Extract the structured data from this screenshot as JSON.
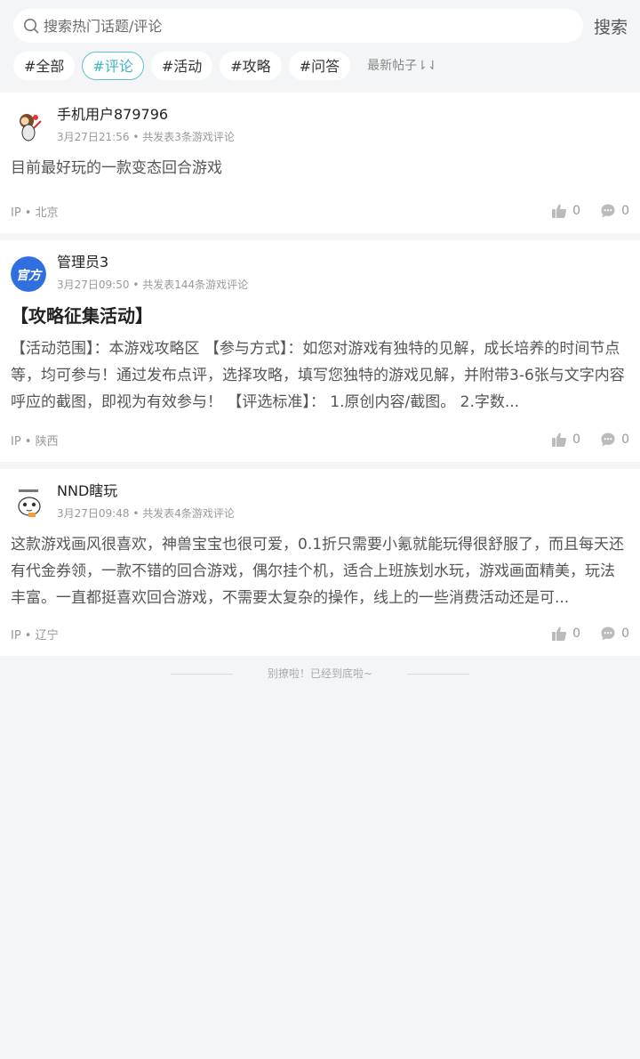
{
  "search": {
    "placeholder": "搜索热门话题/评论",
    "button_label": "搜索"
  },
  "tags": [
    {
      "label": "#全部",
      "active": false
    },
    {
      "label": "#评论",
      "active": true
    },
    {
      "label": "#活动",
      "active": false
    },
    {
      "label": "#攻略",
      "active": false
    },
    {
      "label": "#问答",
      "active": false
    }
  ],
  "sort": {
    "label": "最新帖子⇂⇃"
  },
  "posts": [
    {
      "user": "手机用户879796",
      "time": "3月27日21:56",
      "count": "共发表3条游戏评论",
      "title": "",
      "text": "目前最好玩的一款变态回合游戏",
      "ip": "IP • 北京",
      "likes": "0",
      "comments": "0"
    },
    {
      "user": "管理员3",
      "avatar_label": "官方",
      "time": "3月27日09:50",
      "count": "共发表144条游戏评论",
      "title": "【攻略征集活动】",
      "text": "【活动范围】：本游戏攻略区 【参与方式】：如您对游戏有独特的见解，成长培养的时间节点等，均可参与！通过发布点评，选择攻略，填写您独特的游戏见解，并附带3-6张与文字内容呼应的截图，即视为有效参与！ 【评选标准】： 1.原创内容/截图。 2.字数...",
      "ip": "IP • 陕西",
      "likes": "0",
      "comments": "0"
    },
    {
      "user": "NND瞎玩",
      "time": "3月27日09:48",
      "count": "共发表4条游戏评论",
      "title": "",
      "text": "这款游戏画风很喜欢，神兽宝宝也很可爱，0.1折只需要小氪就能玩得很舒服了，而且每天还有代金券领，一款不错的回合游戏，偶尔挂个机，适合上班族划水玩，游戏画面精美，玩法丰富。一直都挺喜欢回合游戏，不需要太复杂的操作，线上的一些消费活动还是可...",
      "ip": "IP • 辽宁",
      "likes": "0",
      "comments": "0"
    }
  ],
  "end_note": "别撩啦！已经到底啦~",
  "colors": {
    "accent": "#3fb5bd",
    "background": "#f4f5f7",
    "official_avatar": "#2f6fe0"
  }
}
